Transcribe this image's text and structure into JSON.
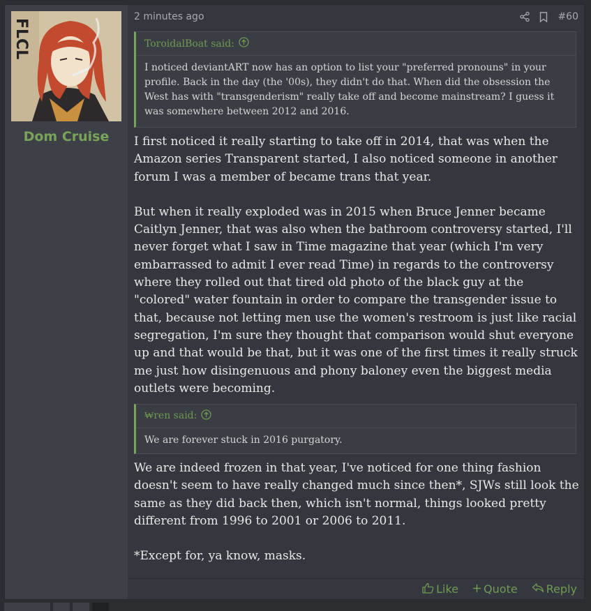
{
  "post": {
    "author": "Dom Cruise",
    "timestamp": "2 minutes ago",
    "post_number": "#60",
    "avatar_text": "FLCL",
    "quotes": [
      {
        "author_label": "ToroidalBoat said:",
        "body": "I noticed deviantART now has an option to list your \"preferred pronouns\" in your profile. Back in the day (the '00s), they didn't do that. When did the obsession the West has with \"transgenderism\" really take off and become mainstream? I guess it was somewhere between 2012 and 2016."
      },
      {
        "author_label": "₩ren said:",
        "body": "We are forever stuck in 2016 purgatory."
      }
    ],
    "paragraphs_1": [
      "I first noticed it really starting to take off in 2014, that was when the Amazon series Transparent started, I also noticed someone in another forum I was a member of became trans that year.",
      "But when it really exploded was in 2015 when Bruce Jenner became Caitlyn Jenner, that was also when the bathroom controversy started, I'll never forget what I saw in Time magazine that year (which I'm very embarrassed to admit I ever read Time) in regards to the controversy where they rolled out that tired old photo of the black guy at the \"colored\" water fountain in order to compare the transgender issue to that, because not letting men use the women's restroom is just like racial segregation, I'm sure they thought that comparison would shut everyone up and that would be that, but it was one of the first times it really struck me just how disingenuous and phony baloney even the biggest media outlets were becoming."
    ],
    "paragraphs_2": [
      "We are indeed frozen in that year, I've noticed for one thing fashion doesn't seem to have really changed much since then*, SJWs still look the same as they did back then, which isn't normal, things looked pretty different from 1996 to 2001 or 2006 to 2011.",
      "*Except for, ya know, masks."
    ],
    "footer": {
      "like": "Like",
      "quote": "Quote",
      "reply": "Reply"
    }
  },
  "icons": {
    "share": "share-icon",
    "bookmark": "bookmark-icon",
    "quote_arrow": "arrow-up-circle-icon",
    "like": "thumbs-up-icon",
    "quote": "plus-icon",
    "reply": "reply-icon"
  },
  "colors": {
    "accent": "#7aa35a",
    "background": "#2b2d31",
    "post_bg": "#34373d",
    "sidebar_bg": "#3d4047"
  }
}
